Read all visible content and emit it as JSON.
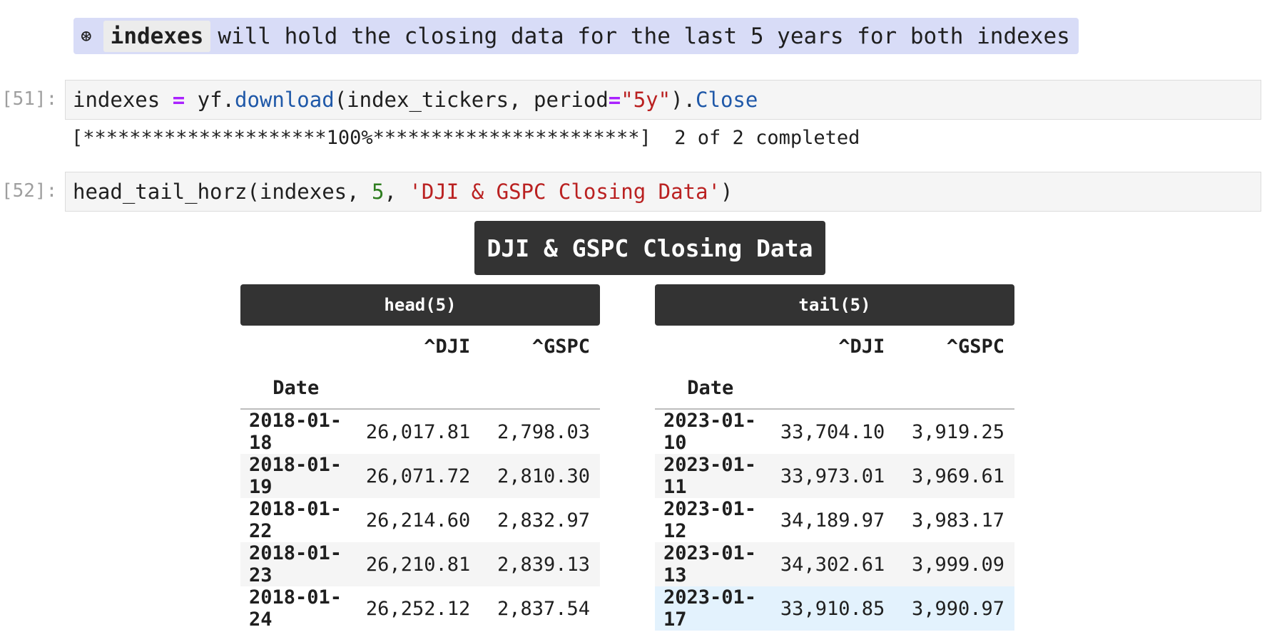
{
  "markdown_note": {
    "bullet": "⊛",
    "code": "indexes",
    "text": "will hold the closing data for the last 5 years for both indexes"
  },
  "cells": [
    {
      "prompt": "[51]:",
      "tokens": [
        {
          "t": "indexes ",
          "c": ""
        },
        {
          "t": "=",
          "c": "tok-op"
        },
        {
          "t": " yf.",
          "c": ""
        },
        {
          "t": "download",
          "c": "tok-fn"
        },
        {
          "t": "(index_tickers, period",
          "c": ""
        },
        {
          "t": "=",
          "c": "tok-op"
        },
        {
          "t": "\"5y\"",
          "c": "tok-str"
        },
        {
          "t": ").",
          "c": ""
        },
        {
          "t": "Close",
          "c": "tok-fn"
        }
      ]
    },
    {
      "prompt": "[52]:",
      "tokens": [
        {
          "t": "head_tail_horz(indexes, ",
          "c": ""
        },
        {
          "t": "5",
          "c": "tok-num"
        },
        {
          "t": ", ",
          "c": ""
        },
        {
          "t": "'DJI & GSPC Closing Data'",
          "c": "tok-str"
        },
        {
          "t": ")",
          "c": ""
        }
      ]
    }
  ],
  "download_output": "[*********************100%***********************]  2 of 2 completed",
  "output_title": "DJI & GSPC Closing Data",
  "panels": [
    {
      "title": "head(5)",
      "columns": [
        "^DJI",
        "^GSPC"
      ],
      "index_name": "Date",
      "rows": [
        [
          "2018-01-18",
          "26,017.81",
          "2,798.03"
        ],
        [
          "2018-01-19",
          "26,071.72",
          "2,810.30"
        ],
        [
          "2018-01-22",
          "26,214.60",
          "2,832.97"
        ],
        [
          "2018-01-23",
          "26,210.81",
          "2,839.13"
        ],
        [
          "2018-01-24",
          "26,252.12",
          "2,837.54"
        ]
      ]
    },
    {
      "title": "tail(5)",
      "columns": [
        "^DJI",
        "^GSPC"
      ],
      "index_name": "Date",
      "rows": [
        [
          "2023-01-10",
          "33,704.10",
          "3,919.25"
        ],
        [
          "2023-01-11",
          "33,973.01",
          "3,969.61"
        ],
        [
          "2023-01-12",
          "34,189.97",
          "3,983.17"
        ],
        [
          "2023-01-13",
          "34,302.61",
          "3,999.09"
        ],
        [
          "2023-01-17",
          "33,910.85",
          "3,990.97"
        ]
      ],
      "highlighted_row": 4
    }
  ]
}
